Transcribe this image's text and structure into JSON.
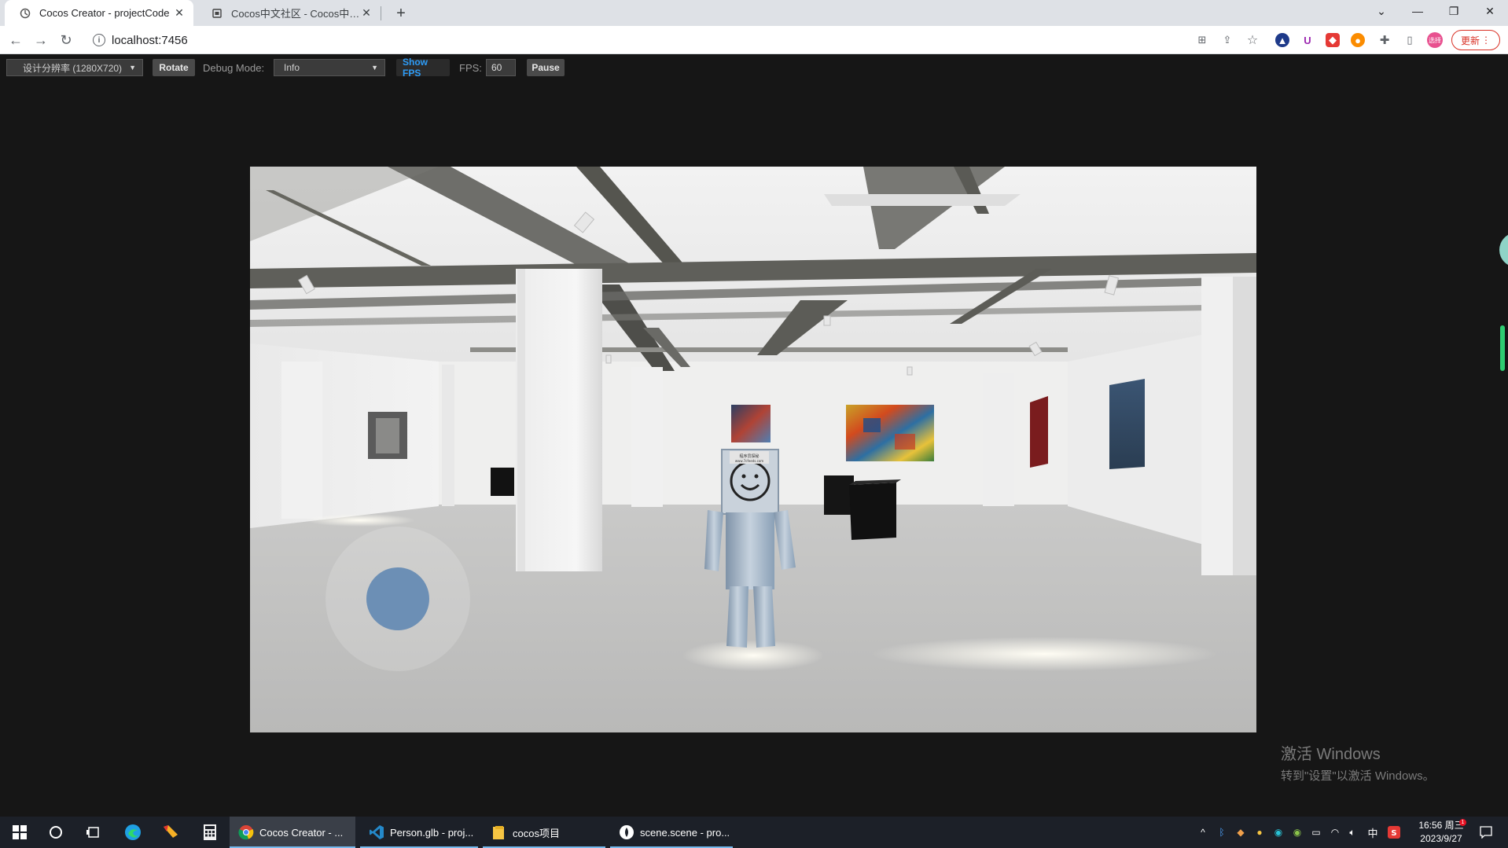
{
  "browser": {
    "tabs": [
      {
        "title": "Cocos Creator - projectCode",
        "active": true
      },
      {
        "title": "Cocos中文社区 - Cocos中文社区",
        "active": false
      }
    ],
    "new_tab_label": "+",
    "url": "localhost:7456",
    "update_label": "更新",
    "avatar_text": "选择"
  },
  "preview_toolbar": {
    "resolution": "设计分辨率 (1280X720)",
    "rotate_label": "Rotate",
    "debug_mode_label": "Debug Mode:",
    "debug_mode_value": "Info",
    "show_fps_label": "Show FPS",
    "fps_label": "FPS:",
    "fps_value": "60",
    "pause_label": "Pause"
  },
  "scene": {
    "joystick_color": "#6c8fb5",
    "robot_sign_text": "程序员探秘",
    "robot_sign_url": "www.7cfeeds.com"
  },
  "watermark": {
    "line1": "激活 Windows",
    "line2": "转到\"设置\"以激活 Windows。"
  },
  "taskbar": {
    "apps": [
      {
        "label": "Cocos Creator - ...",
        "icon": "chrome-icon"
      },
      {
        "label": "Person.glb - proj...",
        "icon": "vscode-icon"
      },
      {
        "label": "cocos项目",
        "icon": "folder-icon"
      },
      {
        "label": "scene.scene - pro...",
        "icon": "cocos-icon"
      }
    ],
    "ime": "中",
    "time": "16:56 周三",
    "date": "2023/9/27",
    "notification_count": "1"
  }
}
